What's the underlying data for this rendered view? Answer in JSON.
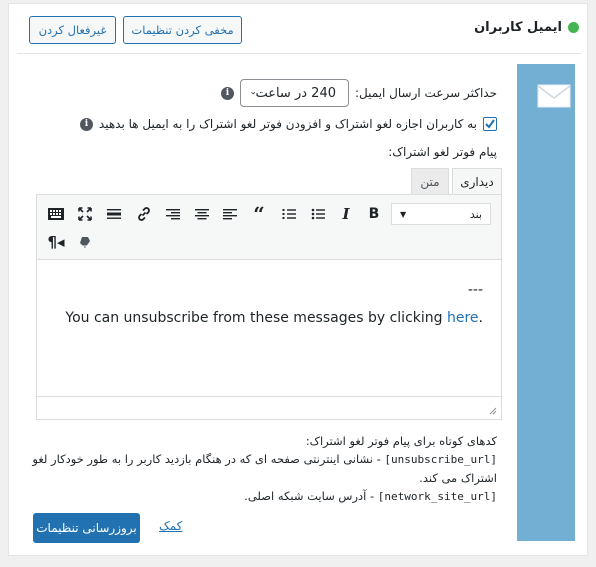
{
  "header": {
    "title": "ایمیل کاربران",
    "status_color": "#46b450",
    "hide_settings_label": "مخفی کردن تنظیمات",
    "disable_label": "غیرفعال کردن"
  },
  "sidebar": {
    "icon": "envelope-icon",
    "color": "#73aed3"
  },
  "settings": {
    "rate_label": "حداکثر سرعت ارسال ایمیل:",
    "rate_value": "240 در ساعت",
    "allow_label": "به کاربران اجازه لغو اشتراک و افزودن فوتر لغو اشتراک را به ایمیل ها بدهید",
    "allow_checked": true,
    "footer_label": "پیام فوتر لغو اشتراک:"
  },
  "editor": {
    "tab_visual": "دیداری",
    "tab_text": "متن",
    "format_value": "بند",
    "content_line1": "---",
    "content_text": "You can unsubscribe from these messages by clicking ",
    "content_link": "here",
    "content_end": "."
  },
  "help": {
    "heading": "کدهای کوتاه برای پیام فوتر لغو اشتراک:",
    "code1": "[unsubscribe_url]",
    "desc1": " - نشانی اینترنتی صفحه ای که در هنگام بازدید کاربر را به طور خودکار لغو اشتراک می کند.",
    "code2": "[network_site_url]",
    "desc2": " - آدرس سایت شبکه اصلی."
  },
  "actions": {
    "update_label": "بروزرسانی تنظیمات",
    "help_label": "کمک"
  }
}
